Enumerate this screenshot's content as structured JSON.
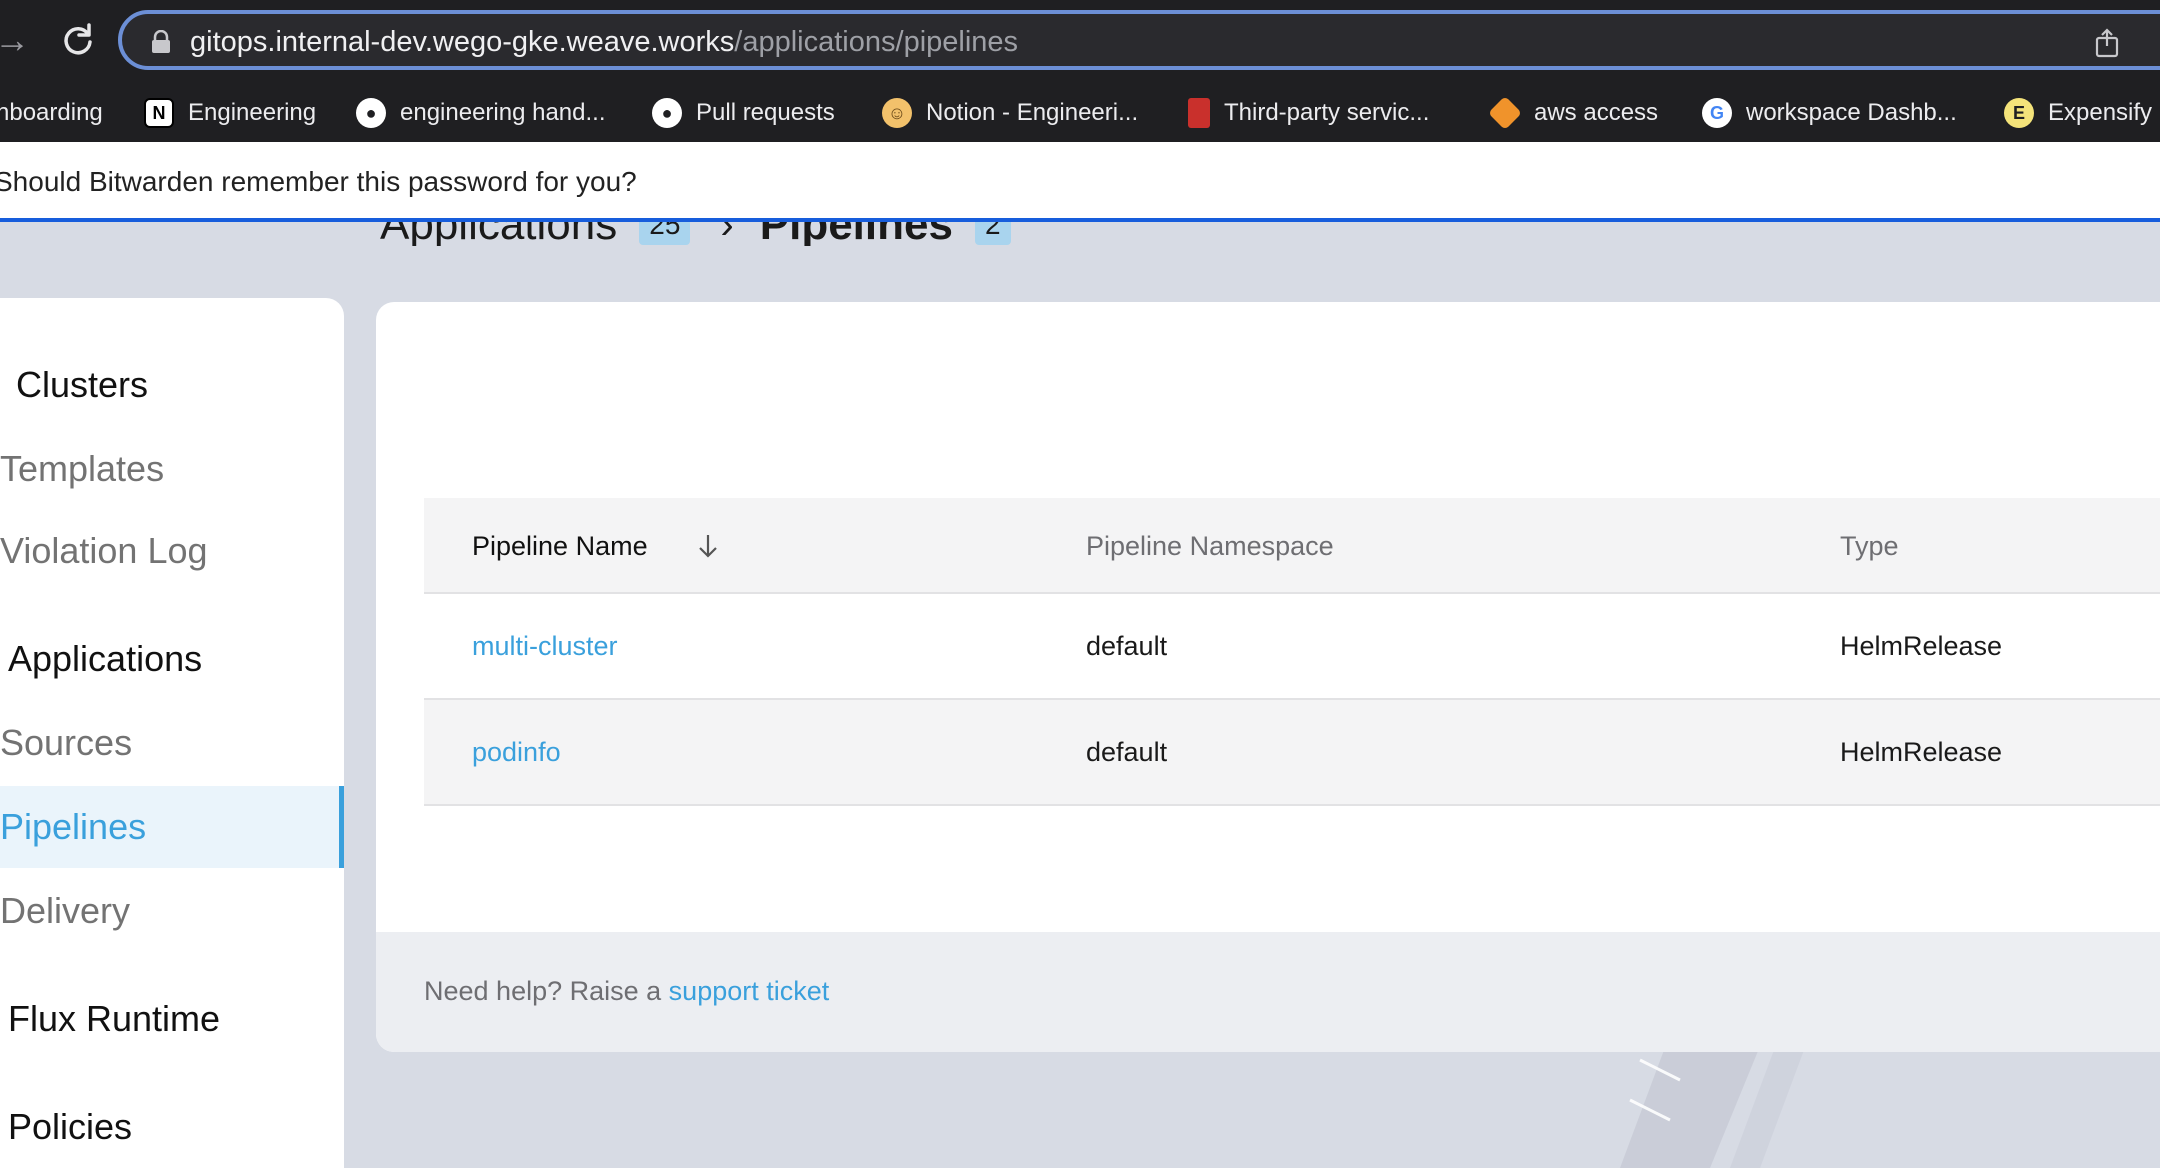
{
  "browser": {
    "url_host": "gitops.internal-dev.wego-gke.weave.works",
    "url_path": "/applications/pipelines",
    "bookmarks": [
      {
        "label": "nboarding",
        "icon": ""
      },
      {
        "label": "Engineering",
        "icon": "notion-icon"
      },
      {
        "label": "engineering hand...",
        "icon": "github-icon"
      },
      {
        "label": "Pull requests",
        "icon": "github-icon"
      },
      {
        "label": "Notion - Engineeri...",
        "icon": "notion-avatar-icon"
      },
      {
        "label": "Third-party servic...",
        "icon": "book-icon"
      },
      {
        "label": "aws access",
        "icon": "aws-box-icon"
      },
      {
        "label": "workspace Dashb...",
        "icon": "google-icon"
      },
      {
        "label": "Expensify",
        "icon": "expensify-icon"
      }
    ]
  },
  "bitwarden": {
    "prompt": "Should Bitwarden remember this password for you?"
  },
  "breadcrumb": {
    "parent": "Applications",
    "parent_count": "25",
    "current": "Pipelines",
    "current_count": "2"
  },
  "sidebar": {
    "items": [
      {
        "label": "Clusters",
        "group": true
      },
      {
        "label": "Templates",
        "group": false
      },
      {
        "label": "Violation Log",
        "group": false
      },
      {
        "label": "Applications",
        "group": true
      },
      {
        "label": "Sources",
        "group": false
      },
      {
        "label": "Pipelines",
        "group": false,
        "active": true
      },
      {
        "label": "Delivery",
        "group": false
      },
      {
        "label": "Flux Runtime",
        "group": true
      },
      {
        "label": "Policies",
        "group": true
      }
    ]
  },
  "table": {
    "columns": [
      "Pipeline Name",
      "Pipeline Namespace",
      "Type"
    ],
    "rows": [
      {
        "name": "multi-cluster",
        "namespace": "default",
        "type": "HelmRelease"
      },
      {
        "name": "podinfo",
        "namespace": "default",
        "type": "HelmRelease"
      }
    ]
  },
  "footer": {
    "help_text": "Need help? Raise a ",
    "help_link": "support ticket"
  },
  "colors": {
    "accent": "#3aa0dc",
    "omnibox_border": "#6c8fd6",
    "bitwarden_line": "#175ddc"
  }
}
